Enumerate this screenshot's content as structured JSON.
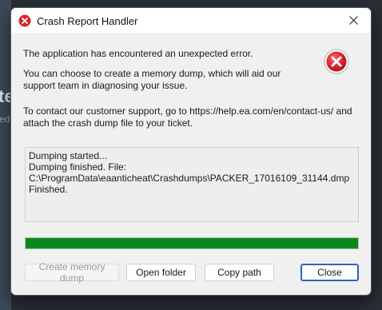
{
  "window": {
    "title": "Crash Report Handler",
    "close_label": "Close window"
  },
  "messages": {
    "line1": "The application has encountered an unexpected error.",
    "line2": "You can choose to create a memory dump, which will aid our support team in diagnosing your issue.",
    "line3": "To contact our customer support, go to https://help.ea.com/en/contact-us/ and attach the crash dump file to your ticket."
  },
  "log": {
    "text": "Dumping started...\nDumping finished. File:\nC:\\ProgramData\\eaanticheat\\Crashdumps\\PACKER_17016109_31144.dmp\nFinished."
  },
  "progress": {
    "percent": 100,
    "color": "#0a8a1e"
  },
  "buttons": {
    "create_dump": "Create memory dump",
    "open_folder": "Open folder",
    "copy_path": "Copy path",
    "close": "Close"
  },
  "colors": {
    "error_red": "#d9242c",
    "accent_blue": "#2a64c8"
  },
  "icons": {
    "title": "error-icon",
    "close": "close-icon",
    "main": "error-icon-large"
  }
}
